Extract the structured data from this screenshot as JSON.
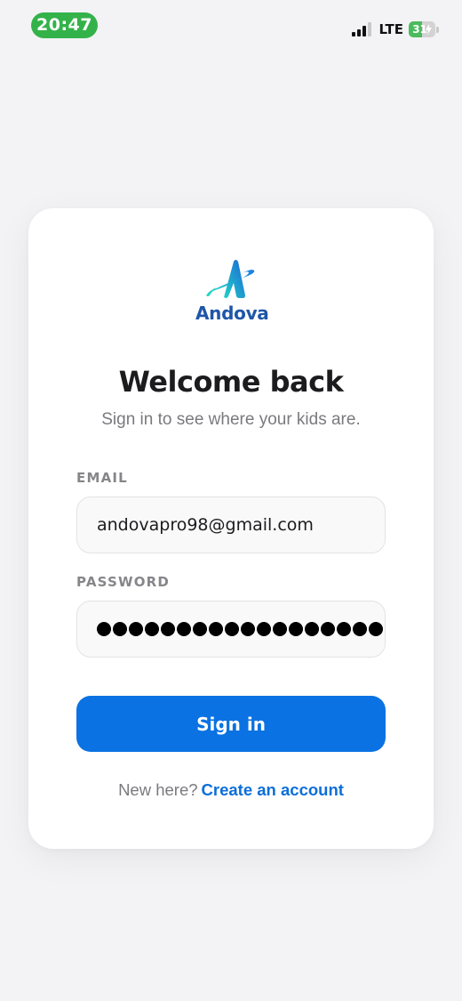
{
  "status_bar": {
    "time": "20:47",
    "network": "LTE",
    "battery_level": "31",
    "battery_fraction": 0.31
  },
  "brand": {
    "name": "Andova",
    "color": "#1f56a8",
    "logo_icon": "andova-a-logo-icon"
  },
  "login": {
    "title": "Welcome back",
    "subtitle": "Sign in to see where your kids are.",
    "email_label": "EMAIL",
    "email_value": "andovapro98@gmail.com",
    "password_label": "PASSWORD",
    "password_length": 18,
    "signin_label": "Sign in",
    "footer_prompt": "New here?",
    "create_account_label": "Create an account"
  },
  "colors": {
    "accent": "#0a72e2",
    "link": "#0b6ed8",
    "status_time_pill": "#34b24a",
    "background": "#f3f3f5"
  }
}
